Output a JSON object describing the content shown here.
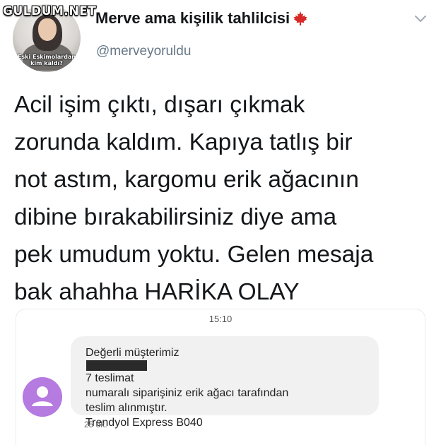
{
  "watermark": "GULDUM.NET",
  "profile": {
    "display_name": "Merve ama kişilik tahlilcisi",
    "handle": "@merveyoruldu",
    "avatar_caption_line1": "Eski Eskimolardan",
    "avatar_caption_line2": "kim kaldı?"
  },
  "tweet": {
    "lines": [
      "Acil işim çıktı, dışarı çıkmak",
      "zorunda kaldım. Kapıya tatlış bir",
      "not astım, kargomu erik ağacının",
      "dibine bırakabilirsiniz diye ama",
      "pek umudum yoktu. Gelen mesaja",
      "bak ahahha HARİKA OLAY"
    ]
  },
  "sms": {
    "time": "15:10",
    "line1_before": "Değerli müşterimiz",
    "line1_after": "7 teslimat",
    "line2": "numaralı siparişiniz erik ağacı tarafından",
    "line3": "teslim alınmıştır.",
    "line4": "Trendyol Express B040",
    "ago": "25 dk."
  },
  "colors": {
    "name_text": "#14171a",
    "handle_text": "#657786",
    "sms_avatar": "#b57be0",
    "bubble_bg": "#f1f1f1",
    "maple_leaf": "#d62828"
  },
  "icons": [
    "maple-leaf-icon",
    "chevron-down-icon",
    "person-icon"
  ]
}
